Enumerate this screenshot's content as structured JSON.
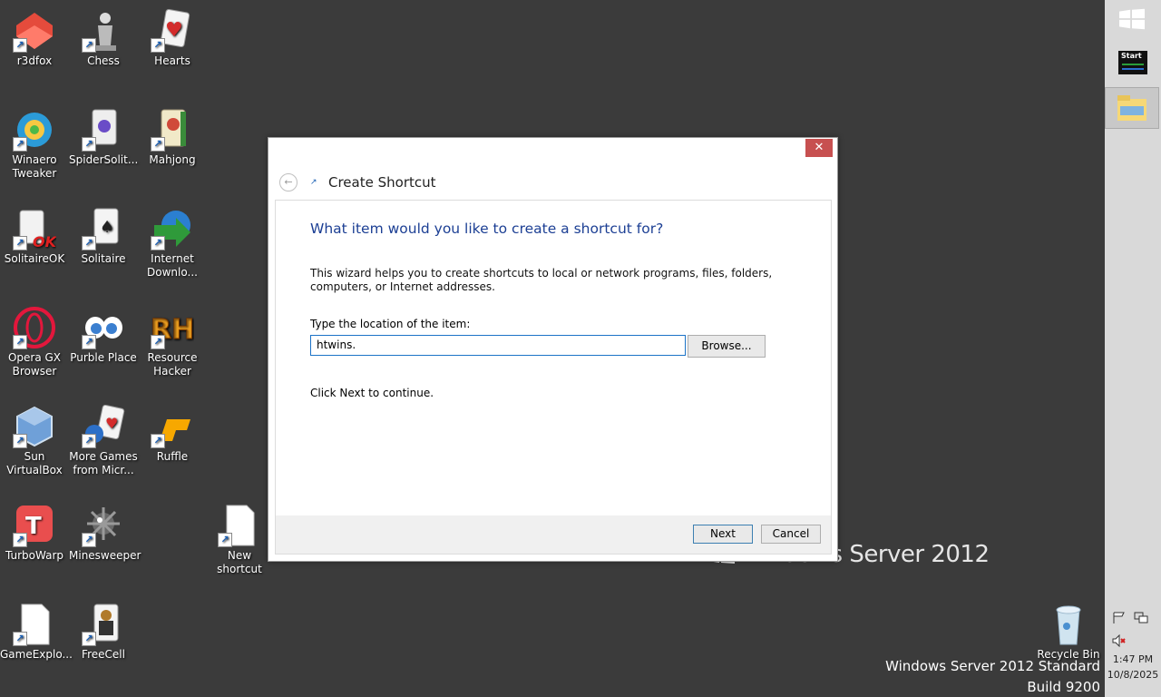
{
  "desktop_icons": [
    {
      "label": "r3dfox",
      "icon": "r3dfox-icon",
      "color": "#e54b3c"
    },
    {
      "label": "Chess",
      "icon": "chess-icon",
      "color": "#bbbbbb"
    },
    {
      "label": "Hearts",
      "icon": "hearts-icon",
      "color": "#d32b2b"
    },
    {
      "label": "Winaero Tweaker",
      "icon": "winaero-tweaker-icon",
      "color": "#2b9bd8"
    },
    {
      "label": "SpiderSolit...",
      "icon": "spider-solitaire-icon",
      "color": "#6a4cc7"
    },
    {
      "label": "Mahjong",
      "icon": "mahjong-icon",
      "color": "#d7c78a"
    },
    {
      "label": "SolitaireOK",
      "icon": "solitaireok-icon",
      "color": "#e02020"
    },
    {
      "label": "Solitaire",
      "icon": "solitaire-icon",
      "color": "#e9e9e9"
    },
    {
      "label": "Internet Downlo...",
      "icon": "internet-download-manager-icon",
      "color": "#2f9a3a"
    },
    {
      "label": "Opera GX Browser",
      "icon": "opera-gx-icon",
      "color": "#e3173c"
    },
    {
      "label": "Purble Place",
      "icon": "purble-place-icon",
      "color": "#3b7fd0"
    },
    {
      "label": "Resource Hacker",
      "icon": "resource-hacker-icon",
      "color": "#f0a020"
    },
    {
      "label": "Sun VirtualBox",
      "icon": "virtualbox-icon",
      "color": "#6fa0d8"
    },
    {
      "label": "More Games from Micr...",
      "icon": "more-games-icon",
      "color": "#2c6fc7"
    },
    {
      "label": "Ruffle",
      "icon": "ruffle-icon",
      "color": "#f7a800"
    },
    {
      "label": "TurboWarp",
      "icon": "turbowarp-icon",
      "color": "#e94e4e"
    },
    {
      "label": "Minesweeper",
      "icon": "minesweeper-icon",
      "color": "#9a9a9a"
    },
    {
      "label": "New shortcut",
      "icon": "new-shortcut-icon",
      "color": "#ffffff"
    },
    {
      "label": "GameExplo...",
      "icon": "game-explorer-icon",
      "color": "#ffffff"
    },
    {
      "label": "FreeCell",
      "icon": "freecell-icon",
      "color": "#b07a2a"
    },
    {
      "label": "Recycle Bin",
      "icon": "recycle-bin-icon",
      "color": "#d0e4f0"
    }
  ],
  "watermark": "Windows Server 2012",
  "system_info": {
    "edition": "Windows Server 2012 Standard",
    "build": "Build 9200"
  },
  "charm_bar": {
    "start_label": "Start",
    "time": "1:47 PM",
    "date": "10/8/2025"
  },
  "dialog": {
    "close_glyph": "✕",
    "title": "Create Shortcut",
    "question": "What item would you like to create a shortcut for?",
    "description": "This wizard helps you to create shortcuts to local or network programs, files, folders, computers, or Internet addresses.",
    "location_label": "Type the location of the item:",
    "location_value": "htwins.",
    "browse_label": "Browse...",
    "continue_text": "Click Next to continue.",
    "next_label": "Next",
    "cancel_label": "Cancel",
    "accent": "#1c3f94"
  }
}
